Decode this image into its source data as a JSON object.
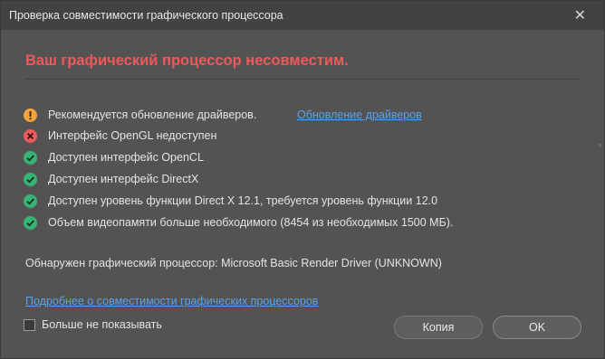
{
  "window": {
    "title": "Проверка совместимости графического процессора",
    "close_glyph": "✕"
  },
  "heading": "Ваш графический процессор несовместим.",
  "checks": [
    {
      "status": "warning",
      "text": "Рекомендуется обновление драйверов."
    },
    {
      "status": "error",
      "text": "Интерфейс OpenGL недоступен"
    },
    {
      "status": "ok",
      "text": "Доступен интерфейс OpenCL"
    },
    {
      "status": "ok",
      "text": "Доступен интерфейс DirectX"
    },
    {
      "status": "ok",
      "text": "Доступен уровень функции Direct X 12.1, требуется уровень функции 12.0"
    },
    {
      "status": "ok",
      "text": "Объем видеопамяти больше необходимого (8454 из необходимых 1500 МБ)."
    }
  ],
  "driver_update_link": "Обновление драйверов",
  "gpu_detected": "Обнаружен графический процессор: Microsoft Basic Render Driver (UNKNOWN)",
  "learn_more_link": "Подробнее о совместимости графических процессоров",
  "dont_show_checkbox": {
    "label": "Больше не показывать",
    "checked": false
  },
  "buttons": {
    "copy": "Копия",
    "ok": "OK"
  },
  "colors": {
    "error": "#f0585a",
    "warning": "#f3a33b",
    "success": "#39b477",
    "link": "#5aa2ee"
  }
}
